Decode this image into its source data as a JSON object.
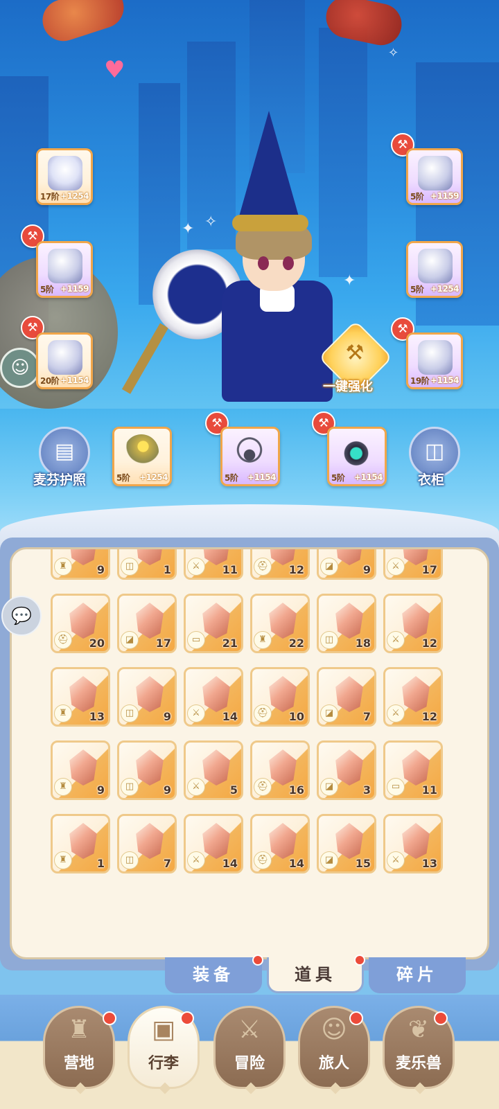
{
  "equipment": {
    "slots": [
      {
        "name": "weapon",
        "tier": "17阶",
        "bonus": "+1254",
        "upgradable": false,
        "rarity": "orange"
      },
      {
        "name": "helmet",
        "tier": "5阶",
        "bonus": "+1159",
        "upgradable": true,
        "rarity": "purple"
      },
      {
        "name": "chest",
        "tier": "5阶",
        "bonus": "+1159",
        "upgradable": true,
        "rarity": "purple"
      },
      {
        "name": "gloves",
        "tier": "5阶",
        "bonus": "+1254",
        "upgradable": false,
        "rarity": "purple"
      },
      {
        "name": "belt",
        "tier": "20阶",
        "bonus": "+1154",
        "upgradable": true,
        "rarity": "orange"
      },
      {
        "name": "boots",
        "tier": "19阶",
        "bonus": "+1154",
        "upgradable": true,
        "rarity": "purple"
      },
      {
        "name": "ring",
        "tier": "5阶",
        "bonus": "+1254",
        "upgradable": false,
        "rarity": "orange"
      },
      {
        "name": "necklace",
        "tier": "5阶",
        "bonus": "+1154",
        "upgradable": true,
        "rarity": "purple"
      },
      {
        "name": "amulet",
        "tier": "5阶",
        "bonus": "+1154",
        "upgradable": true,
        "rarity": "purple"
      }
    ],
    "passport_label": "麦芬护照",
    "wardrobe_label": "衣柜",
    "one_click_label": "一键强化"
  },
  "inventory": {
    "rows": [
      [
        {
          "icon": "armor",
          "count": "9"
        },
        {
          "icon": "pants",
          "count": "1"
        },
        {
          "icon": "sword",
          "count": "11"
        },
        {
          "icon": "helmet",
          "count": "12"
        },
        {
          "icon": "boots",
          "count": "9"
        },
        {
          "icon": "sword",
          "count": "17"
        }
      ],
      [
        {
          "icon": "helmet",
          "count": "20"
        },
        {
          "icon": "boots",
          "count": "17"
        },
        {
          "icon": "bracer",
          "count": "21"
        },
        {
          "icon": "armor",
          "count": "22"
        },
        {
          "icon": "pants",
          "count": "18"
        },
        {
          "icon": "sword",
          "count": "12"
        }
      ],
      [
        {
          "icon": "armor",
          "count": "13"
        },
        {
          "icon": "pants",
          "count": "9"
        },
        {
          "icon": "sword",
          "count": "14"
        },
        {
          "icon": "helmet",
          "count": "10"
        },
        {
          "icon": "boots",
          "count": "7"
        },
        {
          "icon": "sword",
          "count": "12"
        }
      ],
      [
        {
          "icon": "armor",
          "count": "9"
        },
        {
          "icon": "pants",
          "count": "9"
        },
        {
          "icon": "sword",
          "count": "5"
        },
        {
          "icon": "helmet",
          "count": "16"
        },
        {
          "icon": "boots",
          "count": "3"
        },
        {
          "icon": "bracer",
          "count": "11"
        }
      ],
      [
        {
          "icon": "armor",
          "count": "1"
        },
        {
          "icon": "pants",
          "count": "7"
        },
        {
          "icon": "sword",
          "count": "14"
        },
        {
          "icon": "helmet",
          "count": "14"
        },
        {
          "icon": "boots",
          "count": "15"
        },
        {
          "icon": "sword",
          "count": "13"
        }
      ]
    ]
  },
  "subtabs": [
    {
      "label": "装备",
      "active": false,
      "badge": true
    },
    {
      "label": "道具",
      "active": true,
      "badge": true
    },
    {
      "label": "碎片",
      "active": false,
      "badge": false
    }
  ],
  "nav": [
    {
      "label": "营地",
      "icon": "castle-icon",
      "active": false,
      "badge": true
    },
    {
      "label": "行李",
      "icon": "chest-icon",
      "active": true,
      "badge": true
    },
    {
      "label": "冒险",
      "icon": "crossed-swords-icon",
      "active": false,
      "badge": false
    },
    {
      "label": "旅人",
      "icon": "traveler-icon",
      "active": false,
      "badge": true
    },
    {
      "label": "麦乐兽",
      "icon": "pet-icon",
      "active": false,
      "badge": true
    }
  ],
  "colors": {
    "accent": "#f1a64a",
    "badge": "#ec4b3a",
    "panel": "#fbf4e6",
    "frame": "#8faad6"
  }
}
